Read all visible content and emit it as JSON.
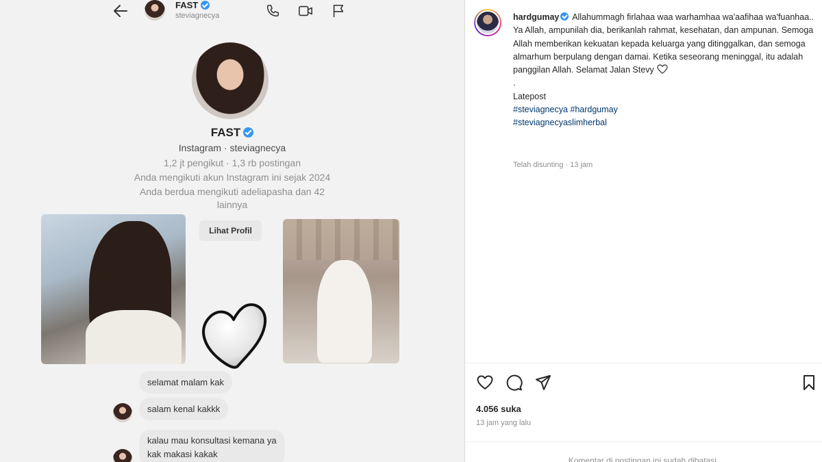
{
  "dm": {
    "name": "FAST",
    "username": "steviagnecya",
    "profile_name": "FAST",
    "profile_source": "Instagram · steviagnecya",
    "stats": "1,2 jt pengikut · 1,3 rb postingan",
    "following_since": "Anda mengikuti akun Instagram ini sejak 2024",
    "mutual_line1": "Anda berdua mengikuti adeliapasha dan 42",
    "mutual_line2": "lainnya",
    "view_profile_label": "Lihat Profil",
    "messages": [
      "selamat malam kak",
      "salam kenal kakkk",
      "kalau mau konsultasi kemana ya",
      "kak makasi kakak"
    ],
    "icons": [
      "back-arrow-icon",
      "phone-icon",
      "video-icon",
      "flag-icon"
    ]
  },
  "post": {
    "author": "hardgumay",
    "caption_intro": "Allahummagh firlahaa waa warhamhaa wa'aafihaa wa'fuanhaa..",
    "caption_body": "Ya Allah, ampunilah dia, berikanlah rahmat, kesehatan, dan ampunan. Semoga Allah memberikan kekuatan kepada keluarga yang ditinggalkan, dan semoga almarhum berpulang dengan damai. Ketika seseorang meninggal, itu adalah panggilan Allah. Selamat Jalan Stevy",
    "caption_dot": ".",
    "caption_latepost": "Latepost",
    "hashtags_line1": "#steviagnecya #hardgumay",
    "hashtags_line2": "#steviagnecyaslimherbal",
    "edited": "Telah disunting",
    "edited_time": "13 jam",
    "likes": "4.056 suka",
    "time_ago": "13 jam yang lalu",
    "comments_notice": "Komentar di postingan ini sudah dibatasi.",
    "icons": [
      "heart-icon",
      "comment-icon",
      "share-icon",
      "bookmark-icon"
    ]
  },
  "colors": {
    "verified": "#3897f0",
    "hashtag": "#00376b",
    "muted": "#8e8e8e",
    "bubble": "#e9e9e9"
  }
}
